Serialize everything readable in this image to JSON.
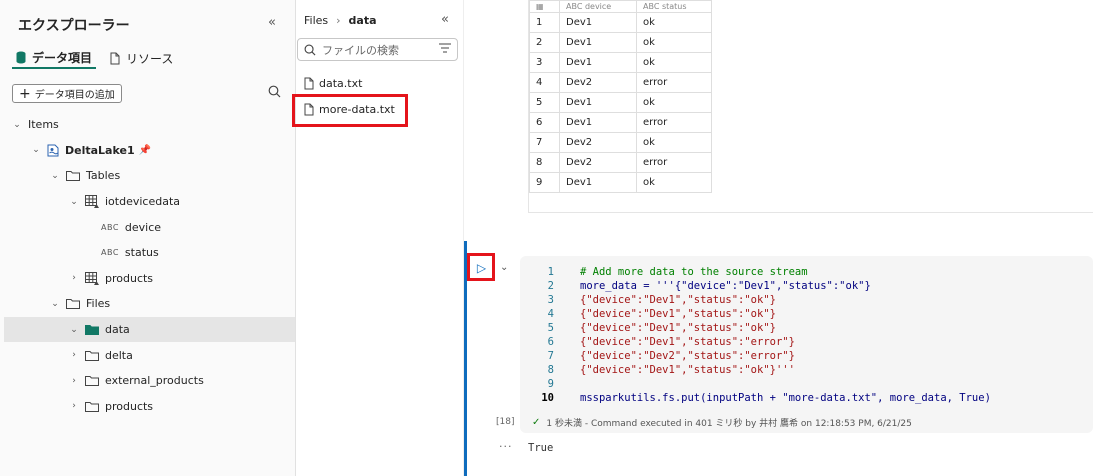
{
  "explorer": {
    "title": "エクスプローラー",
    "collapse_icon": "chevron-double-left-icon",
    "tabs": [
      {
        "label": "データ項目",
        "icon": "database-icon",
        "active": true
      },
      {
        "label": "リソース",
        "icon": "document-icon",
        "active": false
      }
    ],
    "add_button_label": "データ項目の追加",
    "tree": [
      {
        "label": "Items",
        "depth": 0,
        "expanded": true,
        "icon": "none"
      },
      {
        "label": "DeltaLake1",
        "depth": 1,
        "expanded": true,
        "icon": "lakehouse-icon",
        "pinned": true
      },
      {
        "label": "Tables",
        "depth": 2,
        "expanded": true,
        "icon": "folder-icon"
      },
      {
        "label": "iotdevicedata",
        "depth": 3,
        "expanded": true,
        "icon": "delta-table-icon"
      },
      {
        "label": "device",
        "depth": 4,
        "type_tag": "ABC"
      },
      {
        "label": "status",
        "depth": 4,
        "type_tag": "ABC"
      },
      {
        "label": "products",
        "depth": 3,
        "expanded": false,
        "icon": "delta-table-icon"
      },
      {
        "label": "Files",
        "depth": 2,
        "expanded": true,
        "icon": "folder-icon"
      },
      {
        "label": "data",
        "depth": 3,
        "expanded": true,
        "icon": "folder-filled-icon",
        "selected": true
      },
      {
        "label": "delta",
        "depth": 3,
        "expanded": false,
        "icon": "folder-icon"
      },
      {
        "label": "external_products",
        "depth": 3,
        "expanded": false,
        "icon": "folder-icon"
      },
      {
        "label": "products",
        "depth": 3,
        "expanded": false,
        "icon": "folder-icon"
      }
    ]
  },
  "files_pane": {
    "breadcrumb": [
      "Files",
      "data"
    ],
    "search_placeholder": "ファイルの検索",
    "files": [
      "data.txt",
      "more-data.txt"
    ]
  },
  "result_table": {
    "headers": [
      "",
      "ABC device",
      "ABC status"
    ],
    "rows": [
      [
        "1",
        "Dev1",
        "ok"
      ],
      [
        "2",
        "Dev1",
        "ok"
      ],
      [
        "3",
        "Dev1",
        "ok"
      ],
      [
        "4",
        "Dev2",
        "error"
      ],
      [
        "5",
        "Dev1",
        "ok"
      ],
      [
        "6",
        "Dev1",
        "error"
      ],
      [
        "7",
        "Dev2",
        "ok"
      ],
      [
        "8",
        "Dev2",
        "error"
      ],
      [
        "9",
        "Dev1",
        "ok"
      ]
    ]
  },
  "code_cell": {
    "lines": [
      {
        "n": "1",
        "text": "# Add more data to the source stream",
        "kind": "comment"
      },
      {
        "n": "2",
        "text": "more_data = '''{\"device\":\"Dev1\",\"status\":\"ok\"}",
        "kind": "code"
      },
      {
        "n": "3",
        "text": "{\"device\":\"Dev1\",\"status\":\"ok\"}",
        "kind": "str"
      },
      {
        "n": "4",
        "text": "{\"device\":\"Dev1\",\"status\":\"ok\"}",
        "kind": "str"
      },
      {
        "n": "5",
        "text": "{\"device\":\"Dev1\",\"status\":\"ok\"}",
        "kind": "str"
      },
      {
        "n": "6",
        "text": "{\"device\":\"Dev1\",\"status\":\"error\"}",
        "kind": "str"
      },
      {
        "n": "7",
        "text": "{\"device\":\"Dev2\",\"status\":\"error\"}",
        "kind": "str"
      },
      {
        "n": "8",
        "text": "{\"device\":\"Dev1\",\"status\":\"ok\"}'''",
        "kind": "str"
      },
      {
        "n": "9",
        "text": "",
        "kind": "code"
      },
      {
        "n": "10",
        "text": "mssparkutils.fs.put(inputPath + \"more-data.txt\", more_data, True)",
        "kind": "code",
        "current": true
      }
    ],
    "execution_count": "[18]",
    "status_text": "1 秒未満 - Command executed in 401 ミリ秒 by 井村 鷹希 on 12:18:53 PM, 6/21/25",
    "output": "True",
    "ellipsis": "···"
  },
  "colors": {
    "accent": "#117865",
    "highlight": "#e4141b",
    "cell_bar": "#0f6cbd"
  }
}
